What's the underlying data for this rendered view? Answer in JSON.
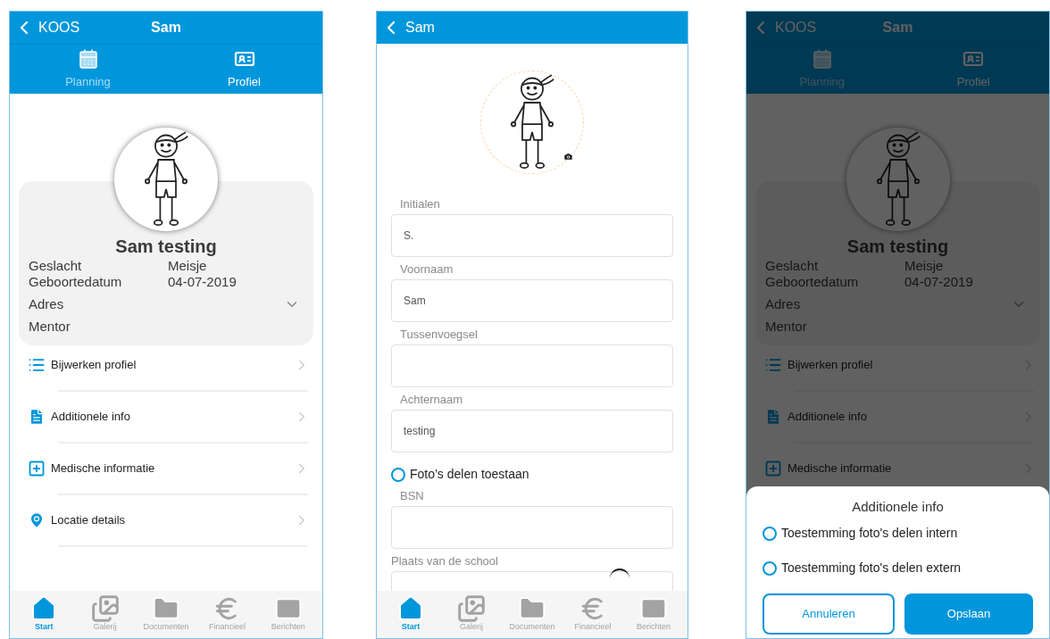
{
  "screens": [
    {
      "kind": "profile",
      "dimmed": false,
      "header": {
        "back": "KOOS",
        "title": "Sam"
      },
      "tabs": [
        {
          "label": "Planning",
          "selected": false
        },
        {
          "label": "Profiel",
          "selected": true
        }
      ],
      "profile": {
        "name": "Sam testing",
        "facts": [
          {
            "label": "Geslacht",
            "value": "Meisje"
          },
          {
            "label": "Geboortedatum",
            "value": "04-07-2019"
          }
        ],
        "rows": [
          {
            "label": "Adres",
            "chevron": true
          },
          {
            "label": "Mentor",
            "chevron": false
          }
        ]
      },
      "menu": [
        {
          "label": "Bijwerken profiel"
        },
        {
          "label": "Additionele info"
        },
        {
          "label": "Medische informatie"
        },
        {
          "label": "Locatie details"
        }
      ],
      "nav": [
        {
          "label": "Start",
          "selected": true
        },
        {
          "label": "Galerij",
          "selected": false
        },
        {
          "label": "Documenten",
          "selected": false
        },
        {
          "label": "Financieel",
          "selected": false
        },
        {
          "label": "Berichten",
          "selected": false
        }
      ]
    },
    {
      "kind": "form",
      "header": {
        "back": "Sam"
      },
      "fields": [
        {
          "kind": "input",
          "label": "Initialen",
          "value": "S."
        },
        {
          "kind": "input",
          "label": "Voornaam",
          "value": "Sam"
        },
        {
          "kind": "input",
          "label": "Tussenvoegsel"
        },
        {
          "kind": "input",
          "label": "Achternaam",
          "value": "testing"
        },
        {
          "kind": "radio",
          "label": "Foto’s delen toestaan",
          "checked": false
        },
        {
          "kind": "input",
          "label": "BSN"
        },
        {
          "kind": "input",
          "label": "Plaats van de school",
          "loading": true
        }
      ],
      "nav": [
        {
          "label": "Start",
          "selected": true
        },
        {
          "label": "Galerij",
          "selected": false
        },
        {
          "label": "Documenten",
          "selected": false
        },
        {
          "label": "Financieel",
          "selected": false
        },
        {
          "label": "Berichten",
          "selected": false
        }
      ]
    },
    {
      "kind": "profile",
      "dimmed": true,
      "header": {
        "back": "KOOS",
        "title": "Sam"
      },
      "tabs": [
        {
          "label": "Planning",
          "selected": false
        },
        {
          "label": "Profiel",
          "selected": true
        }
      ],
      "profile": {
        "name": "Sam testing",
        "facts": [
          {
            "label": "Geslacht",
            "value": "Meisje"
          },
          {
            "label": "Geboortedatum",
            "value": "04-07-2019"
          }
        ],
        "rows": [
          {
            "label": "Adres",
            "chevron": true
          },
          {
            "label": "Mentor",
            "chevron": false
          }
        ]
      },
      "menu": [
        {
          "label": "Bijwerken profiel"
        },
        {
          "label": "Additionele info"
        },
        {
          "label": "Medische informatie"
        }
      ],
      "sheet": {
        "title": "Additionele info",
        "options": [
          {
            "label": "Toestemming foto's delen intern",
            "checked": false
          },
          {
            "label": "Toestemming foto's delen extern",
            "checked": false
          }
        ],
        "buttons": [
          {
            "label": "Annuleren",
            "kind": "outline"
          },
          {
            "label": "Opslaan",
            "kind": "primary"
          }
        ]
      }
    }
  ]
}
